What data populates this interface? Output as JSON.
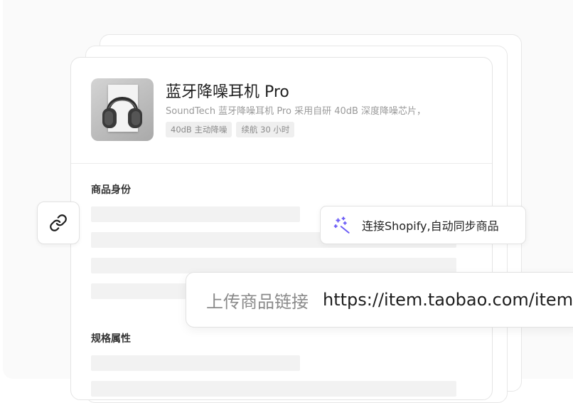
{
  "product": {
    "title": "蓝牙降噪耳机 Pro",
    "description": "SoundTech 蓝牙降噪耳机 Pro 采用自研 40dB 深度降噪芯片，",
    "tags": [
      "40dB 主动降噪",
      "续航 30 小时"
    ],
    "image_icon": "headphones-image"
  },
  "sections": {
    "identity_label": "商品身份",
    "spec_label": "规格属性"
  },
  "link_button": {
    "icon": "link-icon"
  },
  "shopify": {
    "icon": "magic-sparkle-icon",
    "label": "连接Shopify,自动同步商品",
    "accent": "#6b5cf6"
  },
  "url_bar": {
    "label": "上传商品链接",
    "value": "https://item.taobao.com/item"
  }
}
